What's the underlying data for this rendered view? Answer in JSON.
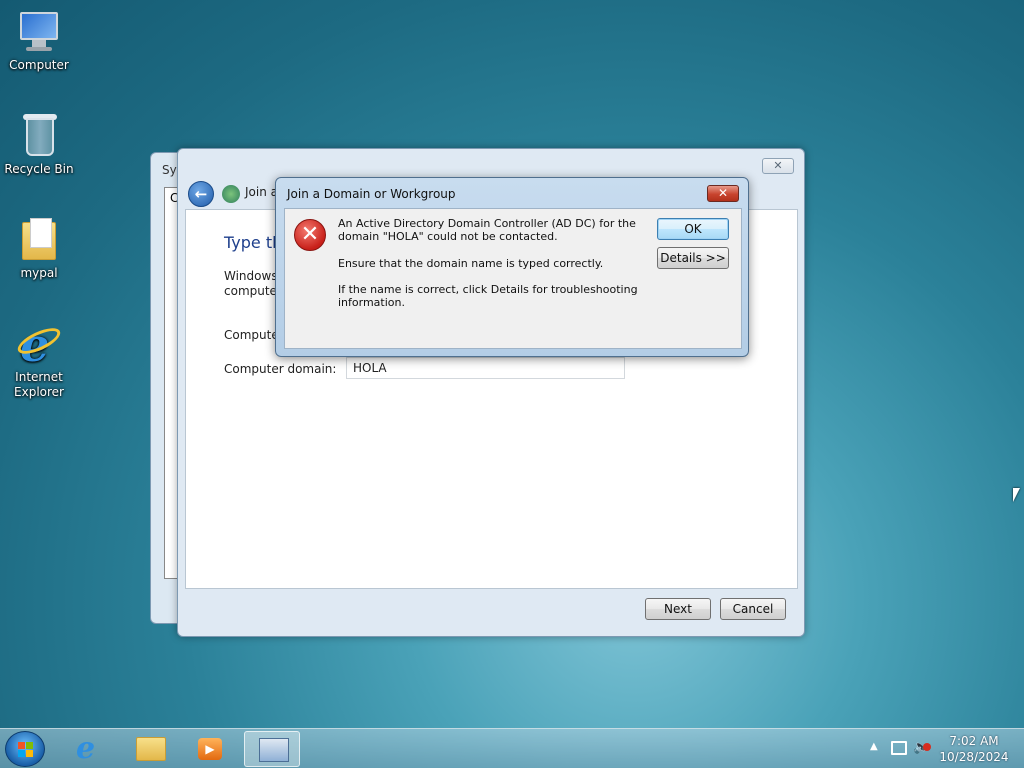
{
  "desktop": {
    "icons": [
      {
        "label": "Computer",
        "icon": "computer-icon"
      },
      {
        "label": "Recycle Bin",
        "icon": "recycle-bin-icon"
      },
      {
        "label": "mypal",
        "icon": "folder-icon"
      },
      {
        "label": "Internet Explorer",
        "icon": "internet-explorer-icon"
      }
    ]
  },
  "back_window": {
    "title_partial": "Sys",
    "inner_partial": "C"
  },
  "wizard": {
    "close_label": "✕",
    "title_partial": "Join a",
    "heading_partial": "Type th",
    "text_partial": "Windows computer",
    "computer_name_label_partial": "Computer",
    "computer_domain_label": "Computer domain:",
    "computer_domain_value": "HOLA",
    "next_label": "Next",
    "cancel_label": "Cancel"
  },
  "dialog": {
    "title": "Join a Domain or Workgroup",
    "close_label": "✕",
    "message_line1": "An Active Directory Domain Controller (AD DC) for the domain \"HOLA\" could not be contacted.",
    "message_line2": "Ensure that the domain name is typed correctly.",
    "message_line3": "If the name is correct, click Details for troubleshooting information.",
    "ok_label": "OK",
    "details_label": "Details >>",
    "icon": "error-icon"
  },
  "taskbar": {
    "pinned": [
      "internet-explorer-icon",
      "file-explorer-icon",
      "media-player-icon",
      "system-properties-icon"
    ],
    "active_item": "system-properties-icon",
    "clock_time": "7:02 AM",
    "clock_date": "10/28/2024"
  },
  "colors": {
    "dialog_heading": "#1e3f8c",
    "close_red": "#c8442e",
    "error_red": "#c8201a"
  }
}
